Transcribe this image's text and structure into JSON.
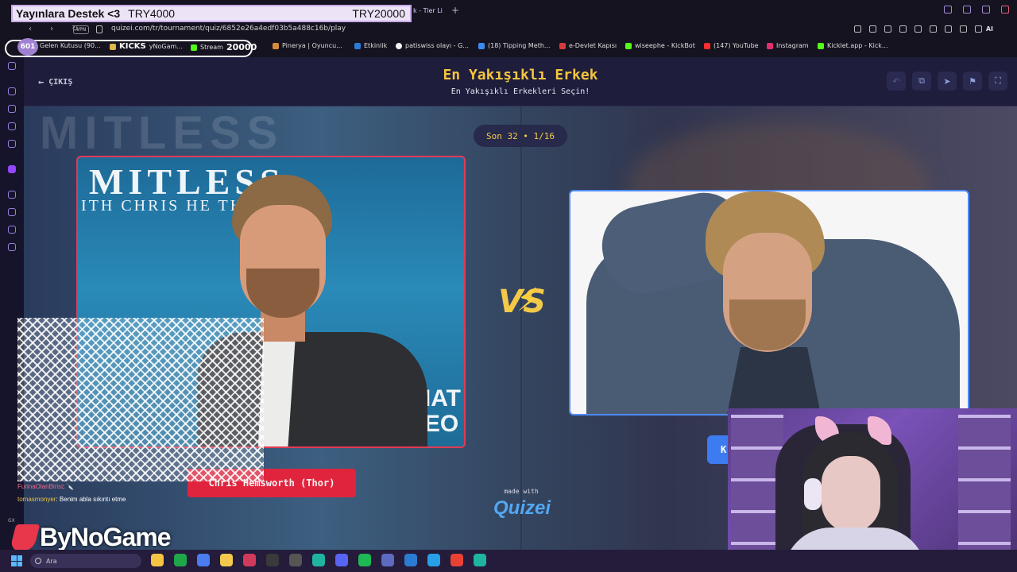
{
  "overlay": {
    "label": "Yayınlara Destek <3",
    "goal_start": "TRY4000",
    "goal_end": "TRY20000"
  },
  "browser": {
    "tab_title": "k - Tier Li",
    "vpn": "VPN",
    "url": "quizei.com/tr/tournament/quiz/6852e26a4edf03b5a488c16b/play",
    "ai_label": "AI"
  },
  "bookmarks": {
    "badge": "601",
    "items": [
      {
        "label": "Gelen Kutusu (90...",
        "color": "#bbbbbb"
      },
      {
        "label": "KICKS",
        "color": "#e0b64a"
      },
      {
        "label": "yNoGam...",
        "color": "#bbbbbb"
      },
      {
        "label": "Stream",
        "color": "#53fc18"
      },
      {
        "label": "20000",
        "color": "#ffffff"
      },
      {
        "label": "Pinerya | Oyuncu...",
        "color": "#d88c3a"
      },
      {
        "label": "Etkinlik",
        "color": "#2a7cd8"
      },
      {
        "label": "patiswiss olayı - G...",
        "color": "#f2f2f2"
      },
      {
        "label": "(18) Tipping Meth...",
        "color": "#3a8bf0"
      },
      {
        "label": "e-Devlet Kapısı",
        "color": "#d83a3a"
      },
      {
        "label": "wiseephe - KickBot",
        "color": "#53fc18"
      },
      {
        "label": "(147) YouTube",
        "color": "#ff2d2d"
      },
      {
        "label": "Instagram",
        "color": "#e1306c"
      },
      {
        "label": "Kicklet.app - Kick...",
        "color": "#53fc18"
      }
    ]
  },
  "header": {
    "back_label": "ÇIKIŞ",
    "title": "En Yakışıklı Erkek",
    "subtitle": "En Yakışıklı Erkekleri Seçin!",
    "buttons": [
      "undo-icon",
      "share-icon",
      "send-icon",
      "flag-icon",
      "fullscreen-icon"
    ]
  },
  "tournament": {
    "round": "Son 32 • 1/16",
    "vs": "VS",
    "left": {
      "name": "Chris Hemsworth (Thor)",
      "poster_main": "MITLESS",
      "poster_sub": "ITH CHRIS HE  TH",
      "poster_side": "IAT\nEO"
    },
    "right": {
      "name_stub": "K"
    }
  },
  "branding": {
    "made_with": "made with",
    "logo": "Quizei"
  },
  "chat": [
    {
      "user": "FurinaOlanBirisi",
      "text": ": 🔪"
    },
    {
      "user": "tomasmonyer",
      "text": ": Benim abla sıkıntı etme"
    }
  ],
  "stream_overlay": {
    "brand": "ByNoGame",
    "gx": "GX"
  },
  "taskbar": {
    "search_placeholder": "Ara",
    "apps": [
      "#f6c343",
      "#1fa64a",
      "#4a7ef0",
      "#f2c94c",
      "#d13a5b",
      "#3a3a3a",
      "#555555",
      "#1fb4a0",
      "#5865f2",
      "#1db954",
      "#5c6bc0",
      "#2b7bd1",
      "#28a0e8",
      "#e94235",
      "#1fb4a0"
    ]
  }
}
